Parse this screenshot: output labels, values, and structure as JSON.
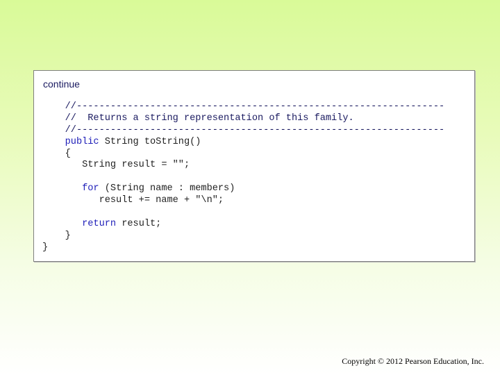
{
  "slide": {
    "continue_label": "continue",
    "copyright": "Copyright © 2012 Pearson Education, Inc."
  },
  "code": {
    "lines": [
      {
        "indent": "    ",
        "tokens": [
          {
            "type": "comment",
            "text": "//-----------------------------------------------------------------"
          }
        ]
      },
      {
        "indent": "    ",
        "tokens": [
          {
            "type": "comment",
            "text": "//  Returns a string representation of this family."
          }
        ]
      },
      {
        "indent": "    ",
        "tokens": [
          {
            "type": "comment",
            "text": "//-----------------------------------------------------------------"
          }
        ]
      },
      {
        "indent": "    ",
        "tokens": [
          {
            "type": "keyword",
            "text": "public"
          },
          {
            "type": "plain",
            "text": " String toString()"
          }
        ]
      },
      {
        "indent": "    ",
        "tokens": [
          {
            "type": "plain",
            "text": "{"
          }
        ]
      },
      {
        "indent": "       ",
        "tokens": [
          {
            "type": "plain",
            "text": "String result = \"\";"
          }
        ]
      },
      {
        "indent": "",
        "tokens": []
      },
      {
        "indent": "       ",
        "tokens": [
          {
            "type": "keyword",
            "text": "for"
          },
          {
            "type": "plain",
            "text": " (String name : members)"
          }
        ]
      },
      {
        "indent": "          ",
        "tokens": [
          {
            "type": "plain",
            "text": "result += name + \"\\n\";"
          }
        ]
      },
      {
        "indent": "",
        "tokens": []
      },
      {
        "indent": "       ",
        "tokens": [
          {
            "type": "keyword",
            "text": "return"
          },
          {
            "type": "plain",
            "text": " result;"
          }
        ]
      },
      {
        "indent": "    ",
        "tokens": [
          {
            "type": "plain",
            "text": "}"
          }
        ]
      },
      {
        "indent": "",
        "tokens": [
          {
            "type": "plain",
            "text": "}"
          }
        ]
      }
    ]
  }
}
